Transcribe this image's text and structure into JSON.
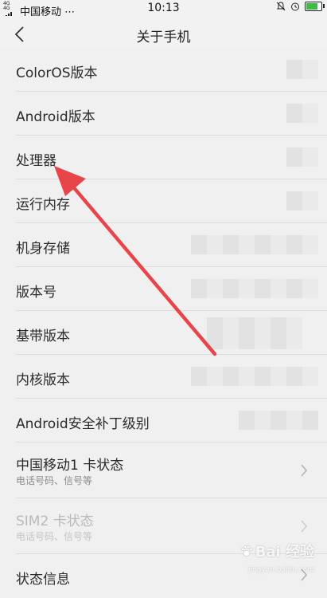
{
  "status_bar": {
    "network": "4G 4G",
    "carrier": "中国移动 ⋯",
    "time": "10:13",
    "icons": [
      "bell-mute-icon",
      "alarm-icon",
      "battery-charging-icon"
    ]
  },
  "nav": {
    "title": "关于手机",
    "back_icon": "chevron-left-icon"
  },
  "items": [
    {
      "label": "ColorOS版本"
    },
    {
      "label": "Android版本"
    },
    {
      "label": "处理器"
    },
    {
      "label": "运行内存"
    },
    {
      "label": "机身存储"
    },
    {
      "label": "版本号"
    },
    {
      "label": "基带版本"
    },
    {
      "label": "内核版本"
    },
    {
      "label": "Android安全补丁级别"
    },
    {
      "label": "中国移动1 卡状态",
      "sublabel": "电话号码、信号等"
    },
    {
      "label": "SIM2 卡状态",
      "sublabel": "电话号码、信号等"
    },
    {
      "label": "状态信息"
    }
  ],
  "watermark": {
    "text": "Bai  经验",
    "sub": "jingyan.baidu.com"
  },
  "colors": {
    "annotation_arrow": "#e8454a",
    "background": "#f0f0f0",
    "battery": "#3dbb45"
  }
}
